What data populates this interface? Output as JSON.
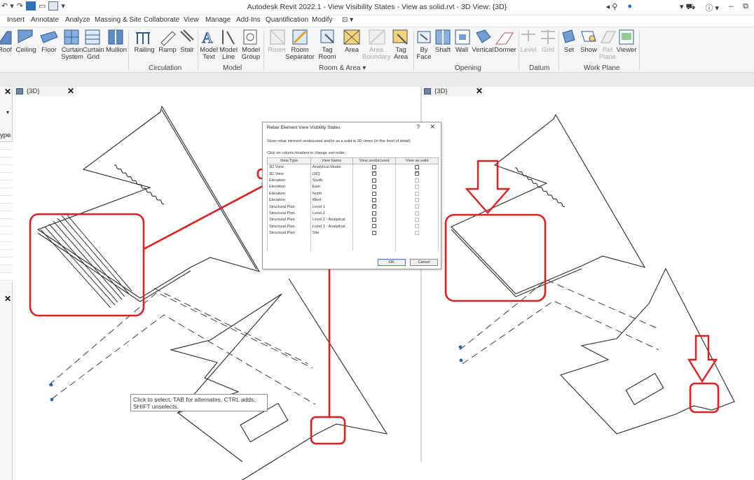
{
  "window": {
    "title": "Autodesk Revit 2022.1 - View Visibility States - View as solid.rvt - 3D View: {3D}",
    "search_icon": "binoculars-icon",
    "user_icon": "user-icon",
    "cart_icon": "cart-icon",
    "help_icon": "help-icon"
  },
  "ribbon_tabs": [
    "Insert",
    "Annotate",
    "Analyze",
    "Massing & Site",
    "Collaborate",
    "View",
    "Manage",
    "Add-Ins",
    "Quantification",
    "Modify"
  ],
  "ribbon": {
    "buttons": [
      {
        "label": "Roof",
        "icon": "roof-icon"
      },
      {
        "label": "Ceiling",
        "icon": "ceiling-icon"
      },
      {
        "label": "Floor",
        "icon": "floor-icon"
      },
      {
        "label": "Curtain\nSystem",
        "icon": "curtain-system-icon"
      },
      {
        "label": "Curtain\nGrid",
        "icon": "curtain-grid-icon"
      },
      {
        "label": "Mullion",
        "icon": "mullion-icon"
      },
      {
        "label": "Railing",
        "icon": "railing-icon"
      },
      {
        "label": "Ramp",
        "icon": "ramp-icon"
      },
      {
        "label": "Stair",
        "icon": "stair-icon"
      },
      {
        "label": "Model\nText",
        "icon": "model-text-icon"
      },
      {
        "label": "Model\nLine",
        "icon": "model-line-icon"
      },
      {
        "label": "Model\nGroup",
        "icon": "model-group-icon"
      },
      {
        "label": "Room",
        "icon": "room-icon"
      },
      {
        "label": "Room\nSeparator",
        "icon": "room-separator-icon"
      },
      {
        "label": "Tag\nRoom",
        "icon": "tag-room-icon"
      },
      {
        "label": "Area",
        "icon": "area-icon"
      },
      {
        "label": "Area\nBoundary",
        "icon": "area-boundary-icon"
      },
      {
        "label": "Tag\nArea",
        "icon": "tag-area-icon"
      },
      {
        "label": "By\nFace",
        "icon": "by-face-icon"
      },
      {
        "label": "Shaft",
        "icon": "shaft-icon"
      },
      {
        "label": "Wall",
        "icon": "wall-opening-icon"
      },
      {
        "label": "Vertical",
        "icon": "vertical-icon"
      },
      {
        "label": "Dormer",
        "icon": "dormer-icon"
      },
      {
        "label": "Level",
        "icon": "level-icon"
      },
      {
        "label": "Grid",
        "icon": "grid-icon"
      },
      {
        "label": "Set",
        "icon": "set-icon"
      },
      {
        "label": "Show",
        "icon": "show-icon"
      },
      {
        "label": "Ref\nPlane",
        "icon": "ref-plane-icon"
      },
      {
        "label": "Viewer",
        "icon": "viewer-icon"
      }
    ],
    "panels": [
      "Circulation",
      "Model",
      "Room & Area",
      "Opening",
      "Datum",
      "Work Plane"
    ]
  },
  "view_tabs": [
    {
      "label": "{3D}"
    },
    {
      "label": "{3D}"
    }
  ],
  "left_panel": {
    "type_label": "ype"
  },
  "dialog": {
    "title": "Rebar Element View Visibility States",
    "help": "?",
    "close": "✕",
    "description": "Show rebar element unobscured and/or as a solid in 3D views (in fine level of detail).",
    "sort_hint": "Click on column headers to change sort order.",
    "columns": [
      "View Type",
      "View Name",
      "View unobscured",
      "View as solid"
    ],
    "rows": [
      {
        "type": "3D View",
        "name": "Analytical Model",
        "unobscured": false,
        "solid": false,
        "solid_enabled": true
      },
      {
        "type": "3D View",
        "name": "{3D}",
        "unobscured": true,
        "solid": true,
        "solid_enabled": true
      },
      {
        "type": "Elevation",
        "name": "South",
        "unobscured": false,
        "solid": false,
        "solid_enabled": false
      },
      {
        "type": "Elevation",
        "name": "East",
        "unobscured": false,
        "solid": false,
        "solid_enabled": false
      },
      {
        "type": "Elevation",
        "name": "North",
        "unobscured": false,
        "solid": false,
        "solid_enabled": false
      },
      {
        "type": "Elevation",
        "name": "West",
        "unobscured": false,
        "solid": false,
        "solid_enabled": false
      },
      {
        "type": "Structural Plan",
        "name": "Level 1",
        "unobscured": true,
        "solid": false,
        "solid_enabled": false
      },
      {
        "type": "Structural Plan",
        "name": "Level 2",
        "unobscured": false,
        "solid": false,
        "solid_enabled": false
      },
      {
        "type": "Structural Plan",
        "name": "Level 2 - Analytical",
        "unobscured": false,
        "solid": false,
        "solid_enabled": false
      },
      {
        "type": "Structural Plan",
        "name": "Level 1 - Analytical",
        "unobscured": false,
        "solid": false,
        "solid_enabled": false
      },
      {
        "type": "Structural Plan",
        "name": "Site",
        "unobscured": false,
        "solid": false,
        "solid_enabled": false
      }
    ],
    "ok_label": "OK",
    "cancel_label": "Cancel"
  },
  "tooltip": "Click to select, TAB for alternates, CTRL adds, SHIFT unselects.",
  "colors": {
    "annotation_red": "#e02020",
    "ribbon_bg": "#f6f6f6",
    "model_line": "#2a2a2a"
  }
}
